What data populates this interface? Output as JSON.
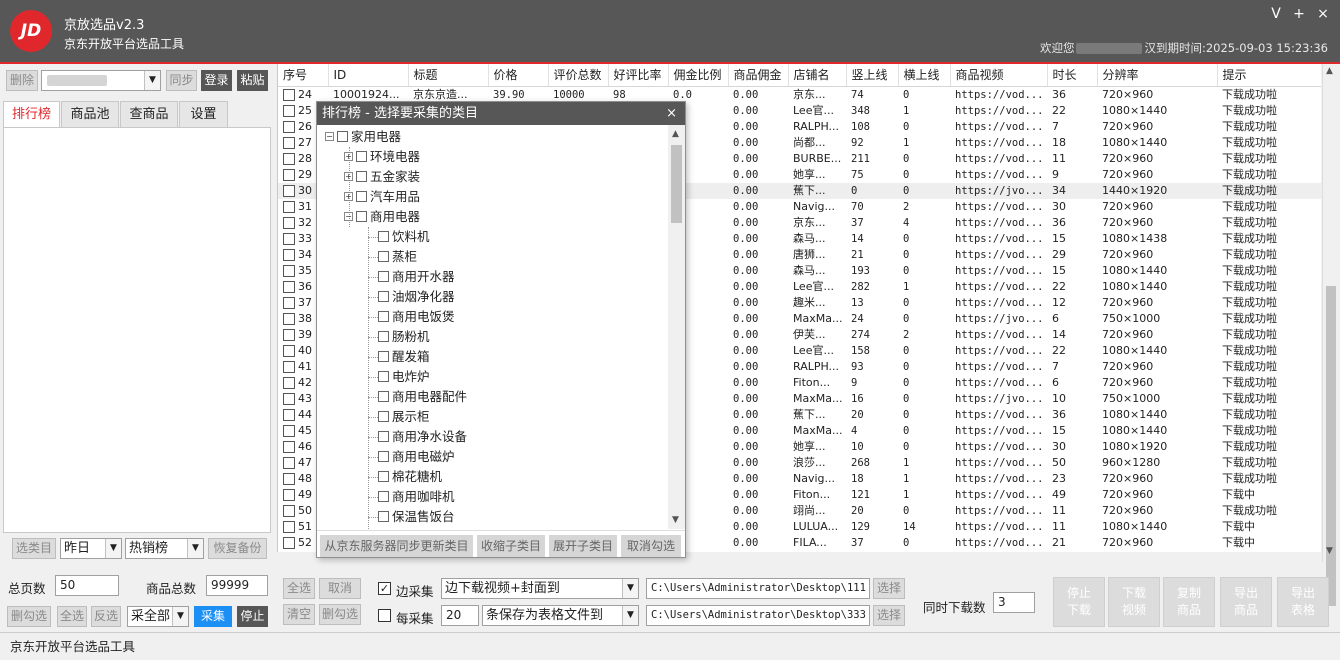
{
  "app": {
    "title": "京放选品v2.3",
    "subtitle": "京东开放平台选品工具",
    "logo": "JD",
    "welcome_prefix": "欢迎您",
    "welcome_suffix": "汉到期时间:2025-09-03 15:23:36",
    "minimize": "V",
    "maximize": "+",
    "close": "×"
  },
  "toolbar": {
    "delete": "删除",
    "sync": "同步",
    "login": "登录",
    "paste": "粘贴"
  },
  "tabs": [
    "排行榜",
    "商品池",
    "查商品",
    "设置"
  ],
  "left_bottom": {
    "select_category": "选类目",
    "period": "昨日",
    "rank_type": "热销榜",
    "restore_backup": "恢复备份",
    "total_pages_label": "总页数",
    "total_pages": "50",
    "total_goods_label": "商品总数",
    "total_goods": "99999",
    "delete_checked": "删勾选",
    "select_all": "全选",
    "invert": "反选",
    "collect_mode": "采全部",
    "collect": "采集",
    "stop": "停止"
  },
  "table": {
    "headers": [
      "序号",
      "ID",
      "标题",
      "价格",
      "评价总数",
      "好评比率",
      "佣金比例",
      "商品佣金",
      "店铺名",
      "竖上线",
      "横上线",
      "商品视频",
      "时长",
      "分辨率",
      "提示"
    ],
    "rows": [
      [
        "24",
        "10001924...",
        "京东京造...",
        "39.90",
        "10000",
        "98",
        "0.0",
        "0.00",
        "京东...",
        "74",
        "0",
        "https://vod...",
        "36",
        "720×960",
        "下载成功啦"
      ],
      [
        "25",
        "",
        "",
        "",
        "",
        "",
        "",
        "0.00",
        "Lee官...",
        "348",
        "1",
        "https://vod...",
        "22",
        "1080×1440",
        "下载成功啦"
      ],
      [
        "26",
        "",
        "",
        "",
        "",
        "",
        "",
        "0.00",
        "RALPH...",
        "108",
        "0",
        "https://vod...",
        "7",
        "720×960",
        "下载成功啦"
      ],
      [
        "27",
        "",
        "",
        "",
        "",
        "",
        "",
        "0.00",
        "尚都...",
        "92",
        "1",
        "https://vod...",
        "18",
        "1080×1440",
        "下载成功啦"
      ],
      [
        "28",
        "",
        "",
        "",
        "",
        "",
        "",
        "0.00",
        "BURBE...",
        "211",
        "0",
        "https://vod...",
        "11",
        "720×960",
        "下载成功啦"
      ],
      [
        "29",
        "",
        "",
        "",
        "",
        "",
        "",
        "0.00",
        "她享...",
        "75",
        "0",
        "https://vod...",
        "9",
        "720×960",
        "下载成功啦"
      ],
      [
        "30",
        "",
        "",
        "",
        "",
        "",
        "",
        "0.00",
        "蕉下...",
        "0",
        "0",
        "https://jvo...",
        "34",
        "1440×1920",
        "下载成功啦"
      ],
      [
        "31",
        "",
        "",
        "",
        "",
        "",
        "",
        "0.00",
        "Navig...",
        "70",
        "2",
        "https://vod...",
        "30",
        "720×960",
        "下载成功啦"
      ],
      [
        "32",
        "",
        "",
        "",
        "",
        "",
        "",
        "0.00",
        "京东...",
        "37",
        "4",
        "https://vod...",
        "36",
        "720×960",
        "下载成功啦"
      ],
      [
        "33",
        "",
        "",
        "",
        "",
        "",
        "",
        "0.00",
        "森马...",
        "14",
        "0",
        "https://vod...",
        "15",
        "1080×1438",
        "下载成功啦"
      ],
      [
        "34",
        "",
        "",
        "",
        "",
        "",
        "",
        "0.00",
        "唐狮...",
        "21",
        "0",
        "https://vod...",
        "29",
        "720×960",
        "下载成功啦"
      ],
      [
        "35",
        "",
        "",
        "",
        "",
        "",
        "",
        "0.00",
        "森马...",
        "193",
        "0",
        "https://vod...",
        "15",
        "1080×1440",
        "下载成功啦"
      ],
      [
        "36",
        "",
        "",
        "",
        "",
        "",
        "",
        "0.00",
        "Lee官...",
        "282",
        "1",
        "https://vod...",
        "22",
        "1080×1440",
        "下载成功啦"
      ],
      [
        "37",
        "",
        "",
        "",
        "",
        "",
        "",
        "0.00",
        "趣米...",
        "13",
        "0",
        "https://vod...",
        "12",
        "720×960",
        "下载成功啦"
      ],
      [
        "38",
        "",
        "",
        "",
        "",
        "",
        "",
        "0.00",
        "MaxMa...",
        "24",
        "0",
        "https://jvo...",
        "6",
        "750×1000",
        "下载成功啦"
      ],
      [
        "39",
        "",
        "",
        "",
        "",
        "",
        "",
        "0.00",
        "伊芙...",
        "274",
        "2",
        "https://vod...",
        "14",
        "720×960",
        "下载成功啦"
      ],
      [
        "40",
        "",
        "",
        "",
        "",
        "",
        "",
        "0.00",
        "Lee官...",
        "158",
        "0",
        "https://vod...",
        "22",
        "1080×1440",
        "下载成功啦"
      ],
      [
        "41",
        "",
        "",
        "",
        "",
        "",
        "",
        "0.00",
        "RALPH...",
        "93",
        "0",
        "https://vod...",
        "7",
        "720×960",
        "下载成功啦"
      ],
      [
        "42",
        "",
        "",
        "",
        "",
        "",
        "",
        "0.00",
        "Fiton...",
        "9",
        "0",
        "https://vod...",
        "6",
        "720×960",
        "下载成功啦"
      ],
      [
        "43",
        "",
        "",
        "",
        "",
        "",
        "",
        "0.00",
        "MaxMa...",
        "16",
        "0",
        "https://jvo...",
        "10",
        "750×1000",
        "下载成功啦"
      ],
      [
        "44",
        "",
        "",
        "",
        "",
        "",
        "",
        "0.00",
        "蕉下...",
        "20",
        "0",
        "https://vod...",
        "36",
        "1080×1440",
        "下载成功啦"
      ],
      [
        "45",
        "",
        "",
        "",
        "",
        "",
        "",
        "0.00",
        "MaxMa...",
        "4",
        "0",
        "https://vod...",
        "15",
        "1080×1440",
        "下载成功啦"
      ],
      [
        "46",
        "",
        "",
        "",
        "",
        "",
        "",
        "0.00",
        "她享...",
        "10",
        "0",
        "https://vod...",
        "30",
        "1080×1920",
        "下载成功啦"
      ],
      [
        "47",
        "",
        "",
        "",
        "",
        "",
        "",
        "0.00",
        "浪莎...",
        "268",
        "1",
        "https://vod...",
        "50",
        "960×1280",
        "下载成功啦"
      ],
      [
        "48",
        "",
        "",
        "",
        "",
        "",
        "",
        "0.00",
        "Navig...",
        "18",
        "1",
        "https://vod...",
        "23",
        "720×960",
        "下载成功啦"
      ],
      [
        "49",
        "",
        "",
        "",
        "",
        "",
        "",
        "0.00",
        "Fiton...",
        "121",
        "1",
        "https://vod...",
        "49",
        "720×960",
        "下载中"
      ],
      [
        "50",
        "",
        "",
        "",
        "",
        "",
        "",
        "0.00",
        "翊尚...",
        "20",
        "0",
        "https://vod...",
        "11",
        "720×960",
        "下载成功啦"
      ],
      [
        "51",
        "",
        "",
        "",
        "",
        "",
        "",
        "0.00",
        "LULUA...",
        "129",
        "14",
        "https://vod...",
        "11",
        "1080×1440",
        "下载中"
      ],
      [
        "52",
        "",
        "",
        "",
        "",
        "",
        "",
        "0.00",
        "FILA...",
        "37",
        "0",
        "https://vod...",
        "21",
        "720×960",
        "下载中"
      ]
    ]
  },
  "dialog": {
    "title": "排行榜 - 选择要采集的类目",
    "close": "×",
    "root": "家用电器",
    "groups": [
      "环境电器",
      "五金家装",
      "汽车用品",
      "商用电器"
    ],
    "items": [
      "饮料机",
      "蒸柜",
      "商用开水器",
      "油烟净化器",
      "商用电饭煲",
      "肠粉机",
      "醒发箱",
      "电炸炉",
      "商用电器配件",
      "展示柜",
      "商用净水设备",
      "商用电磁炉",
      "棉花糖机",
      "商用咖啡机",
      "保温售饭台"
    ],
    "buttons": [
      "从京东服务器同步更新类目",
      "收缩子类目",
      "展开子类目",
      "取消勾选"
    ]
  },
  "bottom": {
    "select_all": "全选",
    "cancel": "取消",
    "clear": "清空",
    "delete_checked": "删勾选",
    "collect_flag_label": "边采集",
    "collect_mode": "边下载视频+封面到",
    "path1": "C:\\Users\\Administrator\\Desktop\\111",
    "choose1": "选择",
    "every_label": "每采集",
    "every_count": "20",
    "save_mode": "条保存为表格文件到",
    "path2": "C:\\Users\\Administrator\\Desktop\\333",
    "choose2": "选择",
    "concurrent_label": "同时下载数",
    "concurrent": "3",
    "stop_download": "停止下载",
    "download_video": "下载视频",
    "copy_goods": "复制商品",
    "export_goods": "导出商品",
    "export_table": "导出表格"
  },
  "status": {
    "text": "京东开放平台选品工具"
  },
  "colors": {
    "accent": "#e0282c",
    "titlebar": "#575757",
    "button_blue": "#1b8ff3"
  }
}
